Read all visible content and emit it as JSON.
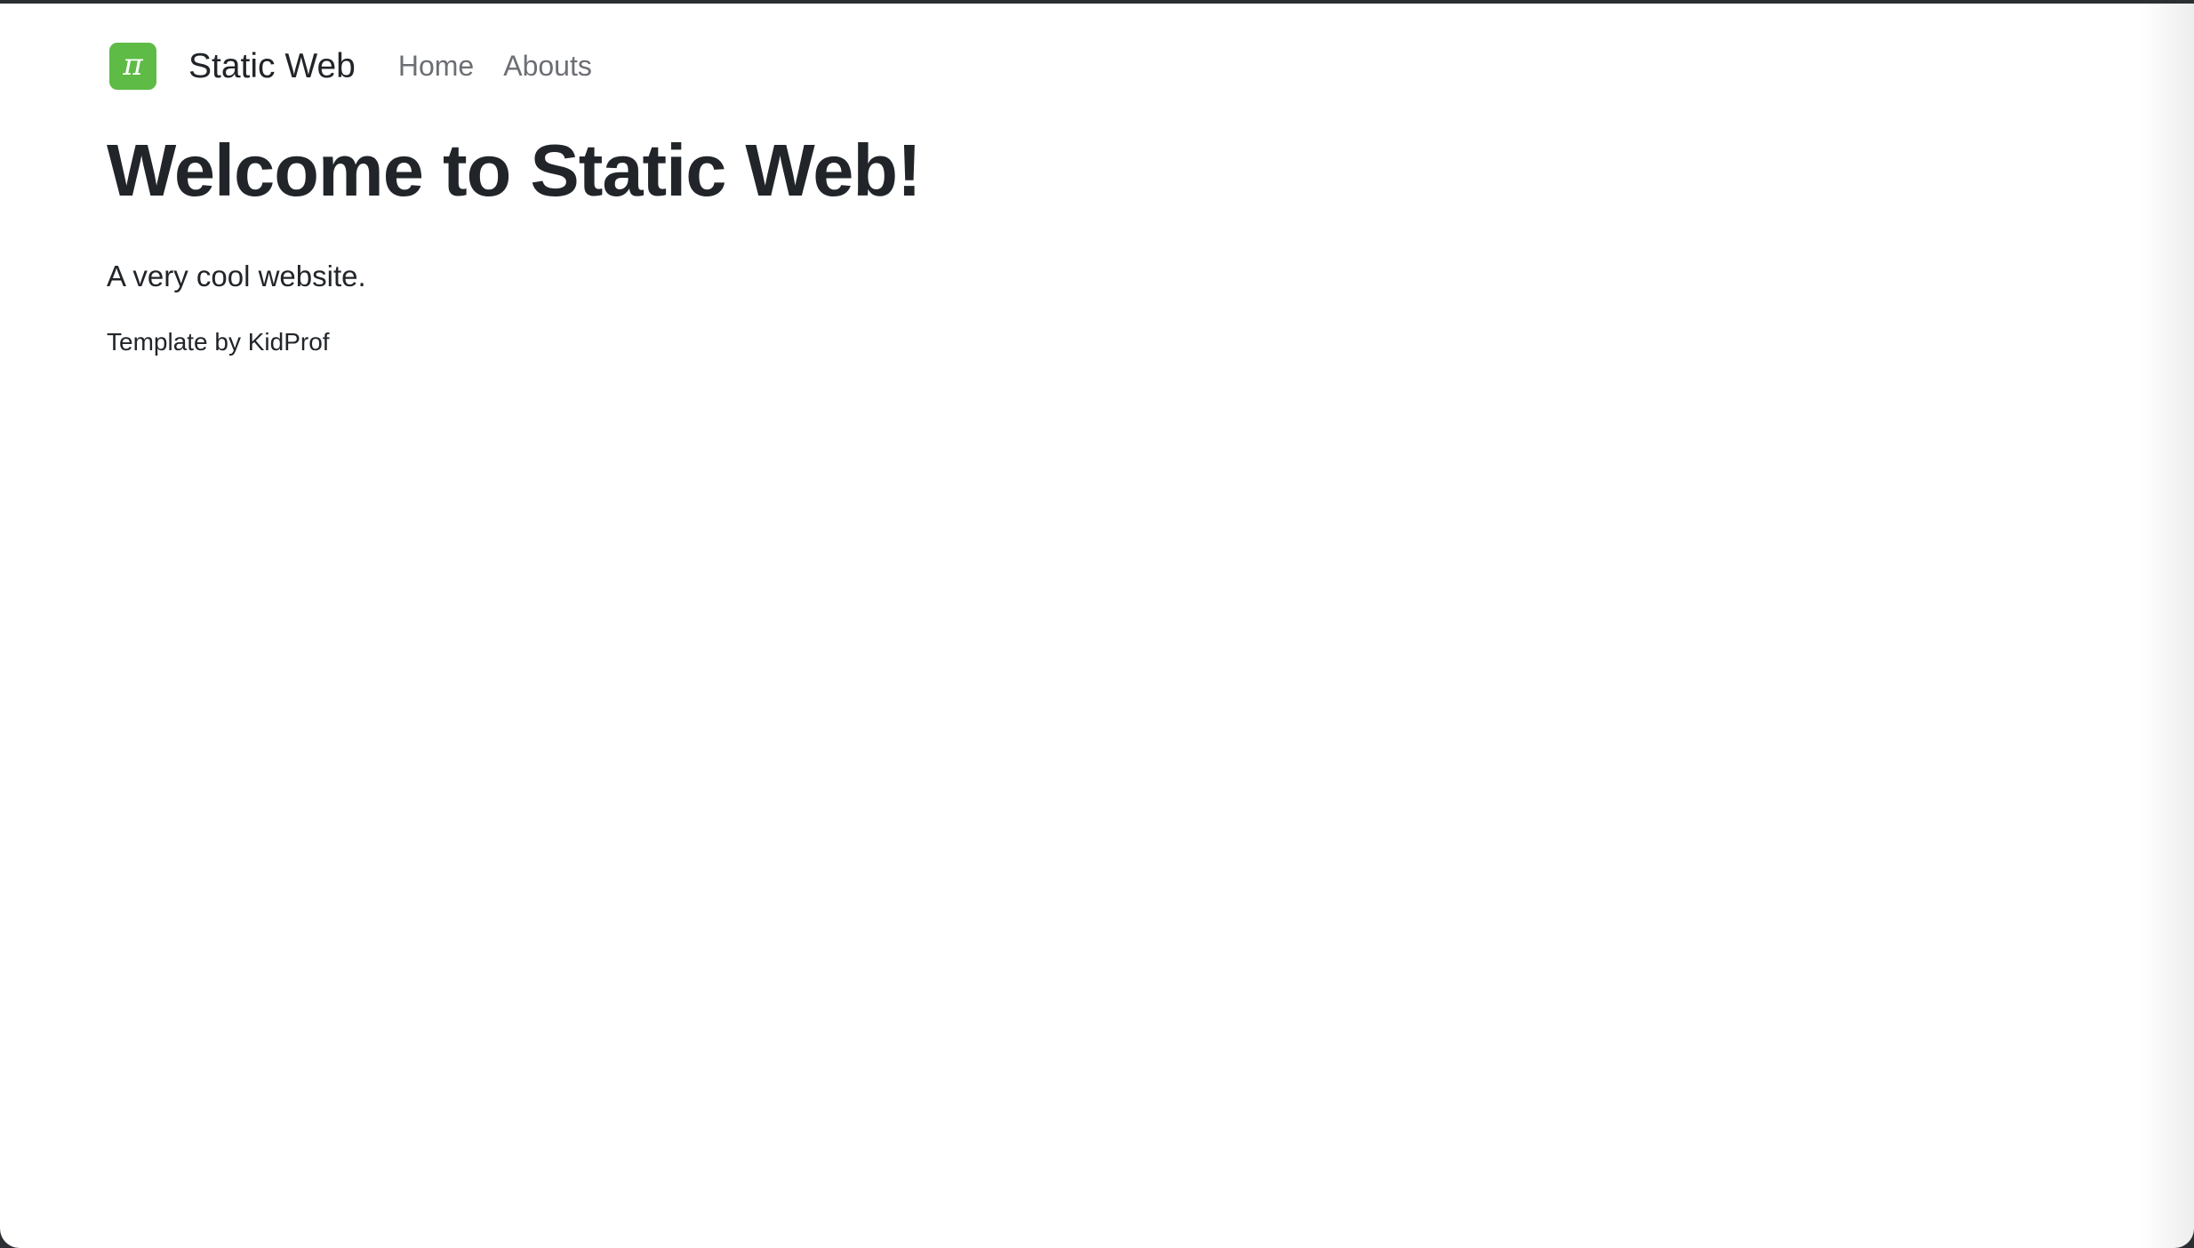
{
  "navbar": {
    "logo_glyph": "π",
    "logo_color": "#5dbb46",
    "brand": "Static Web",
    "links": [
      {
        "label": "Home"
      },
      {
        "label": "Abouts"
      }
    ]
  },
  "main": {
    "title": "Welcome to Static Web!",
    "lead": "A very cool website.",
    "footer": "Template by KidProf"
  }
}
